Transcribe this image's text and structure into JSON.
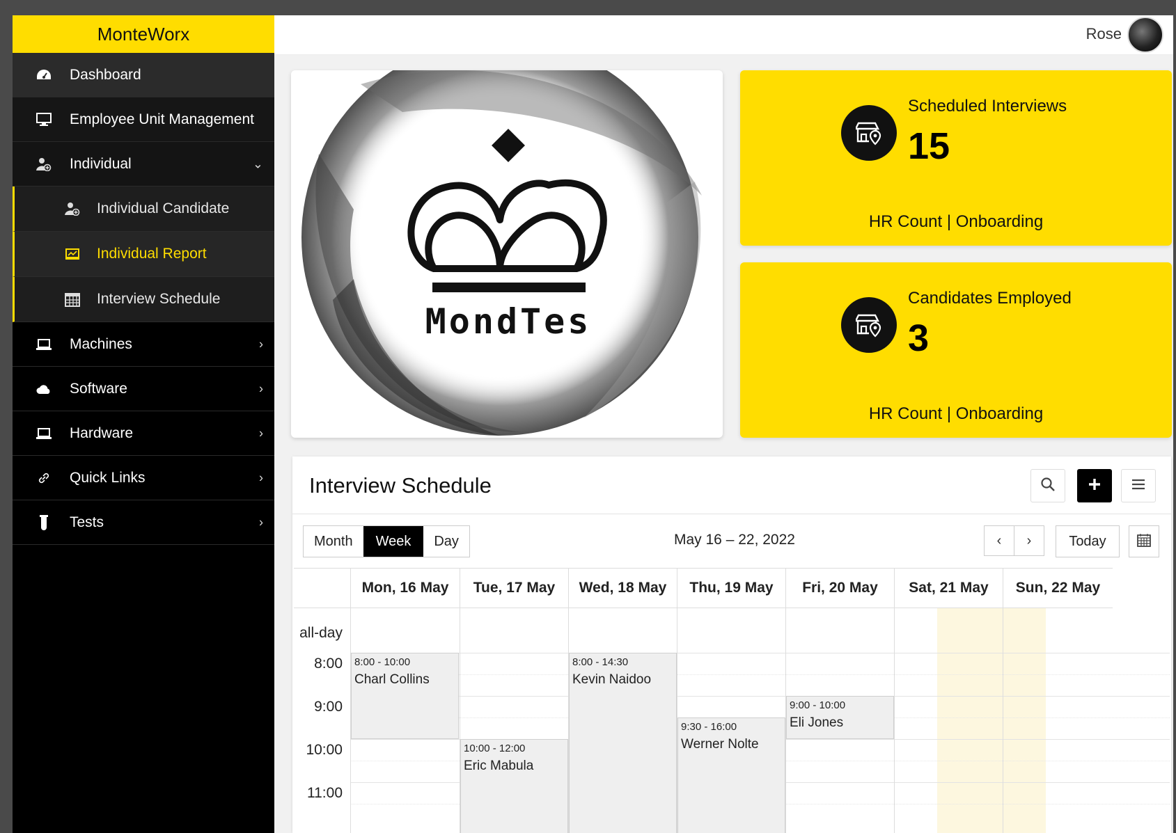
{
  "brand": "MonteWorx",
  "user": {
    "name": "Rose"
  },
  "sidebar": {
    "items": [
      {
        "label": "Dashboard",
        "icon": "dashboard-icon"
      },
      {
        "label": "Employee Unit Management",
        "icon": "monitor-icon"
      },
      {
        "label": "Individual",
        "icon": "user-add-icon",
        "expanded": true
      },
      {
        "label": "Individual Candidate",
        "icon": "user-add-icon"
      },
      {
        "label": "Individual Report",
        "icon": "report-icon",
        "active": true
      },
      {
        "label": "Interview Schedule",
        "icon": "calendar-icon"
      },
      {
        "label": "Machines",
        "icon": "laptop-icon"
      },
      {
        "label": "Software",
        "icon": "cloud-icon"
      },
      {
        "label": "Hardware",
        "icon": "laptop-icon"
      },
      {
        "label": "Quick Links",
        "icon": "link-icon"
      },
      {
        "label": "Tests",
        "icon": "test-tube-icon"
      }
    ]
  },
  "logo": {
    "text": "MondTes"
  },
  "stats": [
    {
      "label": "Scheduled Interviews",
      "value": "15",
      "footer": "HR Count | Onboarding",
      "icon": "store-location-icon"
    },
    {
      "label": "Candidates Employed",
      "value": "3",
      "footer": "HR Count | Onboarding",
      "icon": "store-location-icon"
    }
  ],
  "calendar": {
    "title": "Interview Schedule",
    "views": [
      "Month",
      "Week",
      "Day"
    ],
    "active_view": "Week",
    "range": "May 16 – 22, 2022",
    "today_label": "Today",
    "prev": "‹",
    "next": "›",
    "days": [
      "Mon, 16 May",
      "Tue, 17 May",
      "Wed, 18 May",
      "Thu, 19 May",
      "Fri, 20 May",
      "Sat, 21 May",
      "Sun, 22 May"
    ],
    "allday_label": "all-day",
    "times": [
      "8:00",
      "9:00",
      "10:00",
      "11:00"
    ],
    "events": [
      {
        "time": "8:00 - 10:00",
        "name": "Charl Collins"
      },
      {
        "time": "10:00 - 12:00",
        "name": "Eric Mabula"
      },
      {
        "time": "8:00 - 14:30",
        "name": "Kevin Naidoo"
      },
      {
        "time": "9:30 - 16:00",
        "name": "Werner Nolte"
      },
      {
        "time": "9:00 - 10:00",
        "name": "Eli Jones"
      }
    ]
  },
  "colors": {
    "accent": "#ffdd00",
    "sidebar": "#000000"
  }
}
